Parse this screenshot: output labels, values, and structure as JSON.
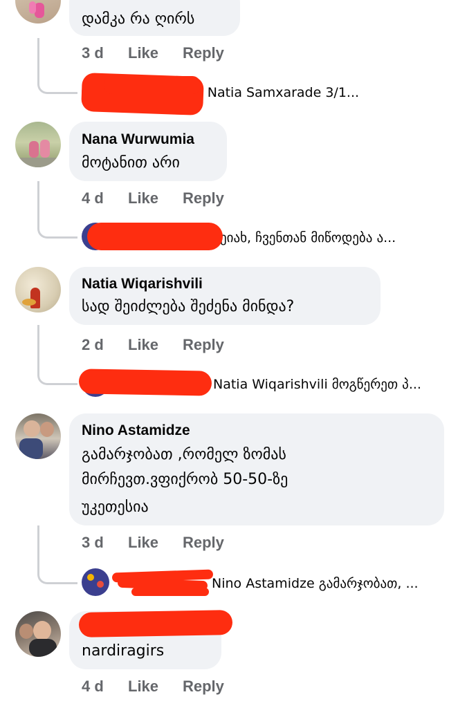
{
  "comments": [
    {
      "author": "",
      "text": "დამკა რა ღირს",
      "time": "3 d",
      "like": "Like",
      "reply": "Reply",
      "reply_preview": "e Natia Samxarade 3/1..."
    },
    {
      "author": "Nana Wurwumia",
      "text": "მოტანით არი",
      "time": "4 d",
      "like": "Like",
      "reply": "Reply",
      "reply_preview": "ეიახ, ჩვენთან მიწოდება ა..."
    },
    {
      "author": "Natia Wiqarishvili",
      "text": "სად შეიძლება შეძენა მინდა?",
      "time": "2 d",
      "like": "Like",
      "reply": "Reply",
      "reply_preview": "Natia Wiqarishvili მოგწერეთ პ..."
    },
    {
      "author": "Nino Astamidze",
      "text_lines": [
        "გამარჯობათ ,რომელ ზომას",
        "მირჩევთ.ვფიქრობ 50-50-ზე",
        "უკეთესია"
      ],
      "time": "3 d",
      "like": "Like",
      "reply": "Reply",
      "reply_preview": "Nino Astamidze გამარჯობათ, ..."
    },
    {
      "author": "",
      "text": "nardiragirs",
      "time": "4 d",
      "like": "Like",
      "reply": "Reply"
    }
  ],
  "colors": {
    "bubble": "#f0f2f5",
    "meta": "#65676b",
    "redaction": "#fe2d10",
    "thread_line": "#ced0d4"
  }
}
